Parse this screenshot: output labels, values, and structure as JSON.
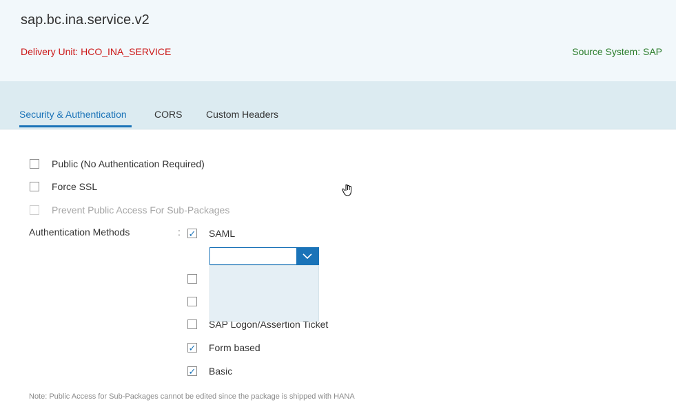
{
  "header": {
    "title": "sap.bc.ina.service.v2",
    "delivery_unit": "Delivery Unit: HCO_INA_SERVICE",
    "source_system": "Source System: SAP"
  },
  "tabs": [
    {
      "label": "Security & Authentication",
      "active": true
    },
    {
      "label": "CORS",
      "active": false
    },
    {
      "label": "Custom Headers",
      "active": false
    }
  ],
  "options": [
    {
      "label": "Public (No Authentication Required)",
      "checked": false,
      "disabled": false
    },
    {
      "label": "Force SSL",
      "checked": false,
      "disabled": false
    },
    {
      "label": "Prevent Public Access For Sub-Packages",
      "checked": false,
      "disabled": true
    }
  ],
  "auth": {
    "label": "Authentication Methods",
    "separator": ":",
    "methods": [
      {
        "label": "SAML",
        "checked": true
      },
      {
        "label": "",
        "checked": false
      },
      {
        "label": "",
        "checked": false
      },
      {
        "label": "SAP Logon/Assertion Ticket",
        "checked": false
      },
      {
        "label": "Form based",
        "checked": true
      },
      {
        "label": "Basic",
        "checked": true
      }
    ],
    "saml_select_value": ""
  },
  "note": "Note: Public Access for Sub-Packages cannot be edited since the package is shipped with HANA",
  "colors": {
    "accent": "#1a73b8",
    "delivery_text": "#cc1919",
    "source_text": "#2b7d2b",
    "header_bg": "#f2f8fb",
    "tabbar_bg": "#dcebf1"
  }
}
